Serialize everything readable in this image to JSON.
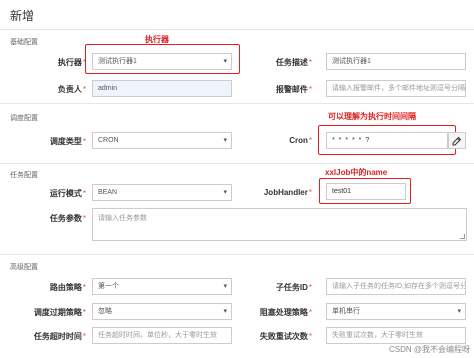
{
  "dialog": {
    "title": "新增"
  },
  "sections": {
    "basic": "基础配置",
    "schedule": "调度配置",
    "task": "任务配置",
    "advanced": "高级配置"
  },
  "annotations": {
    "executor": "执行器",
    "cron": "可以理解为执行时间间隔",
    "handler": "xxlJob中的name"
  },
  "fields": {
    "executor": {
      "label": "执行器",
      "value": "测试执行器1"
    },
    "desc": {
      "label": "任务描述",
      "value": "测试执行器1"
    },
    "owner": {
      "label": "负责人",
      "value": "admin"
    },
    "alarm_email": {
      "label": "报警邮件",
      "placeholder": "请输入报警邮件，多个邮件地址则逗号分隔"
    },
    "schedule_type": {
      "label": "调度类型",
      "value": "CRON"
    },
    "cron": {
      "label": "Cron",
      "value": "* * * * * ?"
    },
    "run_mode": {
      "label": "运行模式",
      "value": "BEAN"
    },
    "job_handler": {
      "label": "JobHandler",
      "value": "test01"
    },
    "task_param": {
      "label": "任务参数",
      "placeholder": "请输入任务参数"
    },
    "route": {
      "label": "路由策略",
      "value": "第一个"
    },
    "child_id": {
      "label": "子任务ID",
      "placeholder": "请输入子任务的任务ID,如存在多个则逗号分隔"
    },
    "misfire": {
      "label": "调度过期策略",
      "value": "忽略"
    },
    "block": {
      "label": "阻塞处理策略",
      "value": "单机串行"
    },
    "timeout": {
      "label": "任务超时时间",
      "placeholder": "任务超时时间，单位秒，大于零时生效"
    },
    "retry": {
      "label": "失败重试次数",
      "placeholder": "失败重试次数，大于零时生效"
    }
  },
  "required_mark": "*",
  "icons": {
    "select_arrow": "▾",
    "edit": "edit-icon"
  },
  "colors": {
    "annotation": "#e02020",
    "required": "#d9534f"
  },
  "watermark": "CSDN @我不会编程呀"
}
